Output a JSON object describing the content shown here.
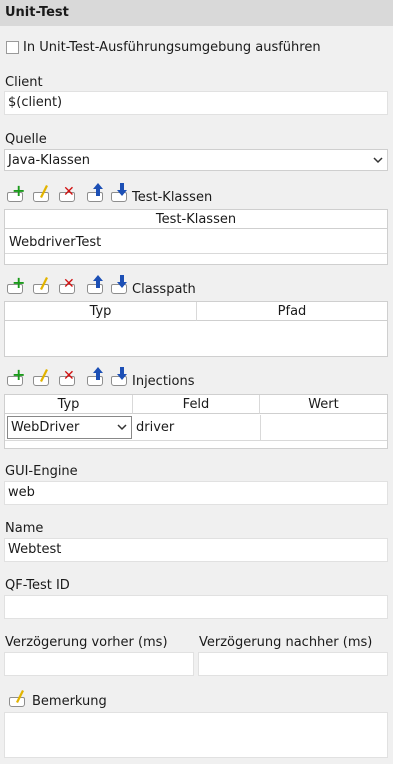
{
  "header": {
    "title": "Unit-Test"
  },
  "options": {
    "run_in_env_label": "In Unit-Test-Ausführungsumgebung ausführen",
    "run_in_env_checked": false
  },
  "client": {
    "label": "Client",
    "value": "$(client)"
  },
  "source": {
    "label": "Quelle",
    "selected": "Java-Klassen"
  },
  "test_classes": {
    "section_label": "Test-Klassen",
    "column": "Test-Klassen",
    "rows": [
      "WebdriverTest"
    ]
  },
  "classpath": {
    "section_label": "Classpath",
    "columns": [
      "Typ",
      "Pfad"
    ]
  },
  "injections": {
    "section_label": "Injections",
    "columns": [
      "Typ",
      "Feld",
      "Wert"
    ],
    "row": {
      "type": "WebDriver",
      "field": "driver",
      "value": ""
    }
  },
  "gui_engine": {
    "label": "GUI-Engine",
    "value": "web"
  },
  "name": {
    "label": "Name",
    "value": "Webtest"
  },
  "qf_id": {
    "label": "QF-Test ID",
    "value": ""
  },
  "delay_before": {
    "label": "Verzögerung vorher (ms)",
    "value": ""
  },
  "delay_after": {
    "label": "Verzögerung nachher (ms)",
    "value": ""
  },
  "comment": {
    "label": "Bemerkung",
    "value": ""
  },
  "toolbar_icons": [
    "add-icon",
    "edit-icon",
    "delete-icon",
    "move-up-icon",
    "move-down-icon"
  ],
  "colors": {
    "add": "#1a9a1a",
    "edit": "#e2b400",
    "delete": "#d01010",
    "move": "#1c4fb5"
  }
}
